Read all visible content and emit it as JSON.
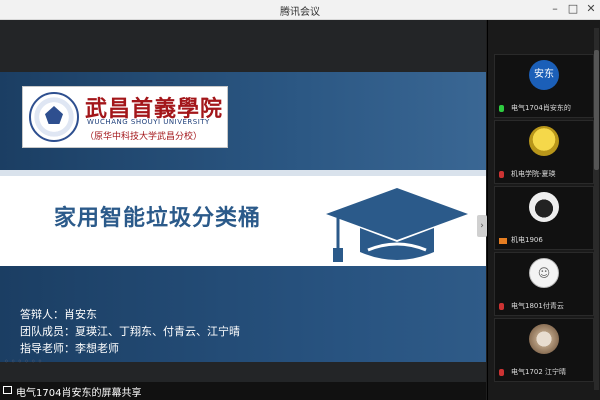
{
  "window": {
    "title": "腾讯会议"
  },
  "slide": {
    "logo": {
      "name_cn": "武昌首義學院",
      "name_en": "WUCHANG SHOUYI UNIVERSITY",
      "subtitle": "（原华中科技大学武昌分校）"
    },
    "title": "家用智能垃圾分类桶",
    "info": {
      "presenter": "答辩人：肖安东",
      "team": "团队成员：夏瑛江、丁翔东、付青云、江宁晴",
      "advisor": "指导老师：李想老师"
    },
    "colors": {
      "accent": "#2b5a8a",
      "band": "#1b3e63",
      "logo_red": "#a3161a"
    }
  },
  "screen_share": {
    "label": "电气1704肖安东的屏幕共享"
  },
  "participants": [
    {
      "avatar_text": "安东",
      "name": "电气1704肖安东的",
      "avatar_color": "#1b5fb8",
      "status": "mic-on"
    },
    {
      "avatar_text": "",
      "name": "机电学院-夏瑛",
      "avatar_color": "#e3c52a",
      "status": "mic-muted"
    },
    {
      "avatar_text": "",
      "name": "机电1906",
      "avatar_color": "#ffffff",
      "status": "camera-off"
    },
    {
      "avatar_text": "",
      "name": "电气1801付青云",
      "avatar_color": "#ffffff",
      "status": "mic-muted"
    },
    {
      "avatar_text": "",
      "name": "电气1702 江宁晴",
      "avatar_color": "#c9b8a4",
      "status": "mic-muted"
    }
  ],
  "icons": {
    "minimize": "minimize-icon",
    "maximize": "maximize-icon",
    "close": "close-icon",
    "collapse": "chevron-right-icon"
  }
}
